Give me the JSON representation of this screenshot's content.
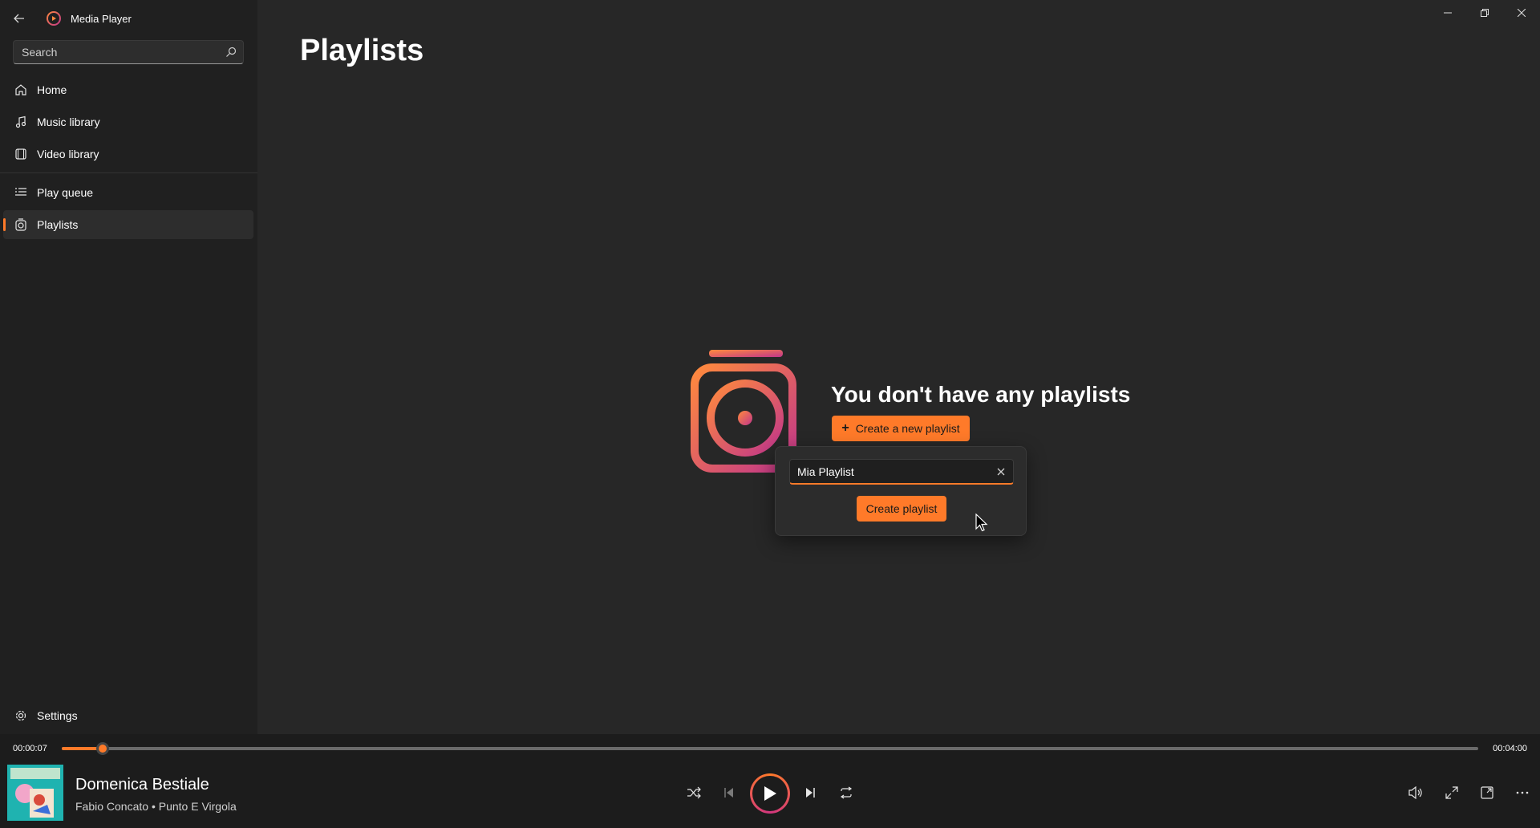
{
  "app": {
    "title": "Media Player",
    "search_placeholder": "Search"
  },
  "sidebar": {
    "items": [
      {
        "label": "Home",
        "icon": "home-icon"
      },
      {
        "label": "Music library",
        "icon": "music-note-icon"
      },
      {
        "label": "Video library",
        "icon": "film-icon"
      },
      {
        "label": "Play queue",
        "icon": "queue-icon"
      },
      {
        "label": "Playlists",
        "icon": "playlist-icon",
        "active": true
      }
    ],
    "settings_label": "Settings"
  },
  "main": {
    "title": "Playlists",
    "empty_heading": "You don't have any playlists",
    "create_button_label": "Create a new playlist"
  },
  "flyout": {
    "input_value": "Mia Playlist",
    "create_button_label": "Create playlist"
  },
  "player": {
    "current_time": "00:00:07",
    "total_time": "00:04:00",
    "progress_fraction": 0.029,
    "song_title": "Domenica Bestiale",
    "artist_line": "Fabio Concato • Punto E Virgola"
  },
  "colors": {
    "accent": "#ff7a29",
    "accent_gradient_end": "#c1368a",
    "background": "#272727",
    "sidebar": "#202020"
  }
}
